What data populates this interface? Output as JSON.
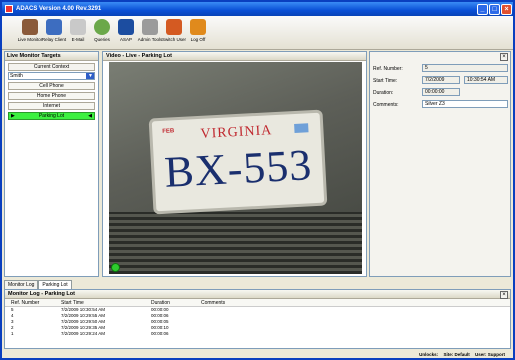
{
  "app": {
    "title": "ADACS Version 4.00 Rev.3291"
  },
  "window_controls": {
    "minimize": "_",
    "maximize": "□",
    "close": "×"
  },
  "toolbar": [
    {
      "label": "Live Monitor",
      "icon": "live-monitor-icon",
      "color": "#8a5a3a"
    },
    {
      "label": "Relay Client",
      "icon": "relay-client-icon",
      "color": "#3d6dc0"
    },
    {
      "label": "E-Mail",
      "icon": "email-icon",
      "color": "#c9c9c9"
    },
    {
      "label": "Queries",
      "icon": "queries-icon",
      "color": "#6ba84a"
    },
    {
      "label": "ASAP",
      "icon": "asap-icon",
      "color": "#1c4da0"
    },
    {
      "label": "Admin Tools",
      "icon": "admin-tools-icon",
      "color": "#9b9b9b"
    },
    {
      "label": "Switch User",
      "icon": "switch-user-icon",
      "color": "#d45a22"
    },
    {
      "label": "Log Off",
      "icon": "log-off-icon",
      "color": "#e08a1c"
    }
  ],
  "left_panel": {
    "title": "Live Monitor Targets",
    "context_label": "Current Context",
    "context_value": "Smith",
    "targets": [
      "Cell Phone",
      "Home Phone",
      "Internet",
      "Parking Lot"
    ],
    "active_target": "Parking Lot"
  },
  "video": {
    "title": "Video - Live - Parking Lot",
    "plate_state": "VIRGINIA",
    "plate_number": "BX-553",
    "plate_month": "FEB"
  },
  "info": {
    "ref_label": "Ref. Number:",
    "ref_value": "5",
    "start_label": "Start Time:",
    "start_date": "7/2/2009",
    "start_time": "10:30:54 AM",
    "duration_label": "Duration:",
    "duration_value": "00:00:00",
    "comments_label": "Comments:",
    "comments_value": "Silver Z3"
  },
  "tabs": [
    "Monitor Log",
    "Parking Lot"
  ],
  "log": {
    "title": "Monitor Log - Parking Lot",
    "columns": [
      "Ref. Number",
      "Start Time",
      "Duration",
      "Comments"
    ],
    "rows": [
      {
        "ref": "5",
        "start": "7/2/2009 10:30:54 AM",
        "duration": "00:00:00",
        "comments": ""
      },
      {
        "ref": "4",
        "start": "7/2/2009 10:29:55 AM",
        "duration": "00:00:06",
        "comments": ""
      },
      {
        "ref": "3",
        "start": "7/2/2009 10:29:50 AM",
        "duration": "00:00:05",
        "comments": ""
      },
      {
        "ref": "2",
        "start": "7/2/2009 10:29:35 AM",
        "duration": "00:00:10",
        "comments": ""
      },
      {
        "ref": "1",
        "start": "7/2/2009 10:29:24 AM",
        "duration": "00:00:06",
        "comments": ""
      }
    ]
  },
  "status": {
    "unlocks": "Unlocks:",
    "site": "Site: Default",
    "user": "User: Support"
  }
}
